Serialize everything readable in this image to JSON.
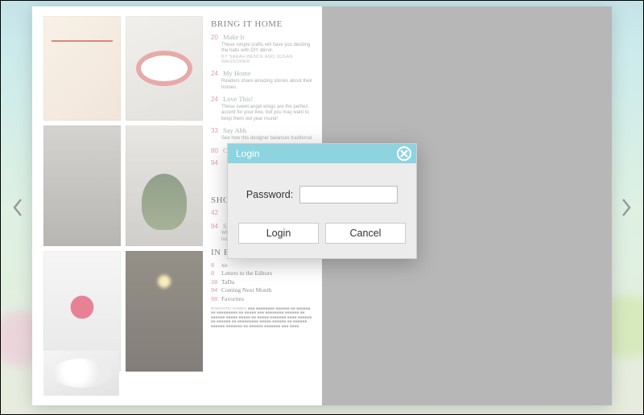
{
  "modal": {
    "title": "Login",
    "password_label": "Password:",
    "password_value": "",
    "login_label": "Login",
    "cancel_label": "Cancel"
  },
  "nav": {
    "prev_icon": "chevron-left",
    "next_icon": "chevron-right"
  },
  "magazine": {
    "sections": [
      {
        "heading": "BRING IT HOME",
        "entries": [
          {
            "num": "20",
            "title": "Make It",
            "desc": "These simple crafts will have you decking the halls with DIY décor.",
            "byline": "BY SARAH BENCE AND SUSAN WAGGONER"
          },
          {
            "num": "24",
            "title": "My Home",
            "desc": "Readers share amazing stories about their homes."
          },
          {
            "num": "24",
            "title": "Love This!",
            "desc": "These sweet angel wings are the perfect accent for your tree, but you may want to keep them out year round!"
          },
          {
            "num": "33",
            "title": "Say Ahh",
            "desc": "See how this designer balances traditional"
          },
          {
            "num": "80",
            "title": "Cr",
            "desc": ""
          },
          {
            "num": "94",
            "title": "",
            "desc": ""
          }
        ]
      },
      {
        "heading": "SHO",
        "entries": [
          {
            "num": "42",
            "title": "",
            "desc": ""
          },
          {
            "num": "94",
            "title": "Shopping",
            "desc": "Where to find the products featured in this issue."
          }
        ]
      },
      {
        "heading": "IN EVERY ISSUE",
        "entries": [
          {
            "num": "8",
            "title": "xo"
          },
          {
            "num": "8",
            "title": "Letters to the Editors"
          },
          {
            "num": "38",
            "title": "TaDa"
          },
          {
            "num": "94",
            "title": "Coming Next Month"
          },
          {
            "num": "98",
            "title": "Favorites"
          }
        ]
      }
    ]
  }
}
